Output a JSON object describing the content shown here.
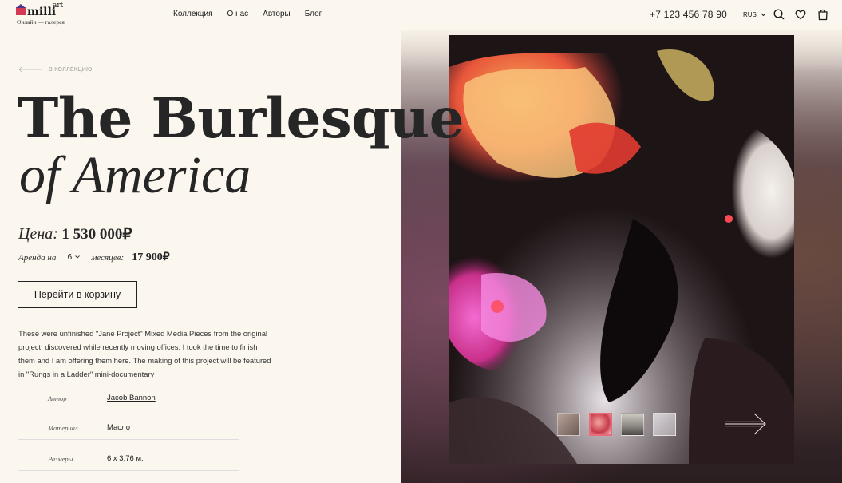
{
  "logo": {
    "name": "milli",
    "sup": "art",
    "tagline": "Онлайн — галерея"
  },
  "nav": [
    "Коллекция",
    "О нас",
    "Авторы",
    "Блог"
  ],
  "header": {
    "phone": "+7 123 456 78 90",
    "lang": "RUS"
  },
  "back_link": "В КОЛЛЕКЦИЮ",
  "title": {
    "line1": "The Burlesque",
    "line2": "of America"
  },
  "price": {
    "label": "Цена:",
    "value": "1 530 000₽"
  },
  "rent": {
    "label": "Аренда на",
    "months": "6",
    "suffix": "месяцев:",
    "value": "17 900₽"
  },
  "cart_button": "Перейти в корзину",
  "description": "These were unfinished \"Jane Project\" Mixed Media Pieces from the original project, discovered while recently moving offices. I took the time to finish them and I am offering them here. The making of this project will be featured in \"Rungs in a Ladder\" mini-documentary",
  "specs": [
    {
      "label": "Автор",
      "value": "Jacob Bannon"
    },
    {
      "label": "Материал",
      "value": "Масло"
    },
    {
      "label": "Размеры",
      "value": "6 x 3,76 м."
    }
  ],
  "colors": {
    "accent": "#e96c7a",
    "text": "#262626",
    "background": "#fbf7ef"
  },
  "gallery": {
    "thumbnail_count": 4,
    "active_index": 1
  }
}
